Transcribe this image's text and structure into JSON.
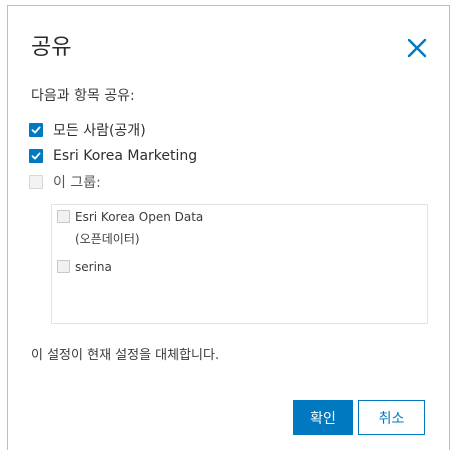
{
  "dialog": {
    "title": "공유",
    "close_icon": "close-icon",
    "prompt": "다음과 항목 공유:",
    "options": [
      {
        "label": "모든 사람(공개)",
        "checked": true,
        "enabled": true
      },
      {
        "label": "Esri Korea Marketing",
        "checked": true,
        "enabled": true
      },
      {
        "label": "이 그룹:",
        "checked": false,
        "enabled": false
      }
    ],
    "groups": [
      {
        "label_line1": "Esri Korea Open Data",
        "label_line2": "(오픈데이터)",
        "checked": false
      },
      {
        "label_line1": "serina",
        "label_line2": "",
        "checked": false
      }
    ],
    "note": "이 설정이 현재 설정을 대체합니다.",
    "ok_label": "확인",
    "cancel_label": "취소",
    "colors": {
      "accent": "#0079c1"
    }
  }
}
